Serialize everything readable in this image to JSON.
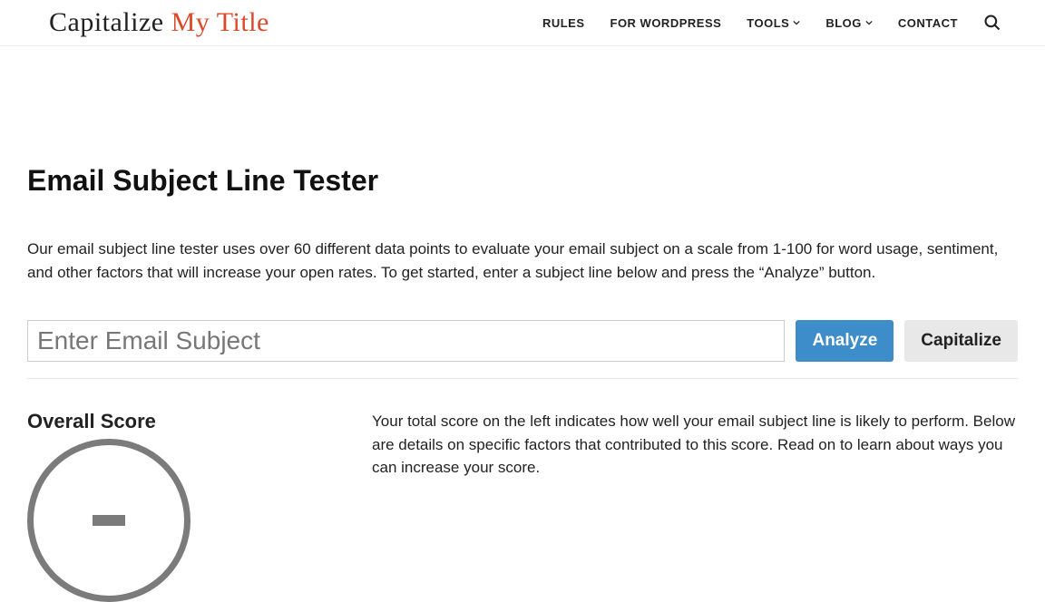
{
  "logo": {
    "dark": "Capitalize ",
    "accent": "My Title"
  },
  "nav": {
    "rules": "RULES",
    "wordpress": "FOR WORDPRESS",
    "tools": "TOOLS",
    "blog": "BLOG",
    "contact": "CONTACT"
  },
  "page": {
    "title": "Email Subject Line Tester",
    "intro": "Our email subject line tester uses over 60 different data points to evaluate your email subject on a scale from 1-100 for word usage,  sentiment, and other factors that will increase your open rates. To get started, enter a subject line below and press the “Analyze” button."
  },
  "form": {
    "placeholder": "Enter Email Subject",
    "analyze": "Analyze",
    "capitalize": "Capitalize"
  },
  "score": {
    "title": "Overall Score",
    "desc": "Your total score on the left indicates how well your email subject line is likely to perform. Below are details on specific factors that contributed to this score. Read on to learn about ways you can increase your score."
  }
}
